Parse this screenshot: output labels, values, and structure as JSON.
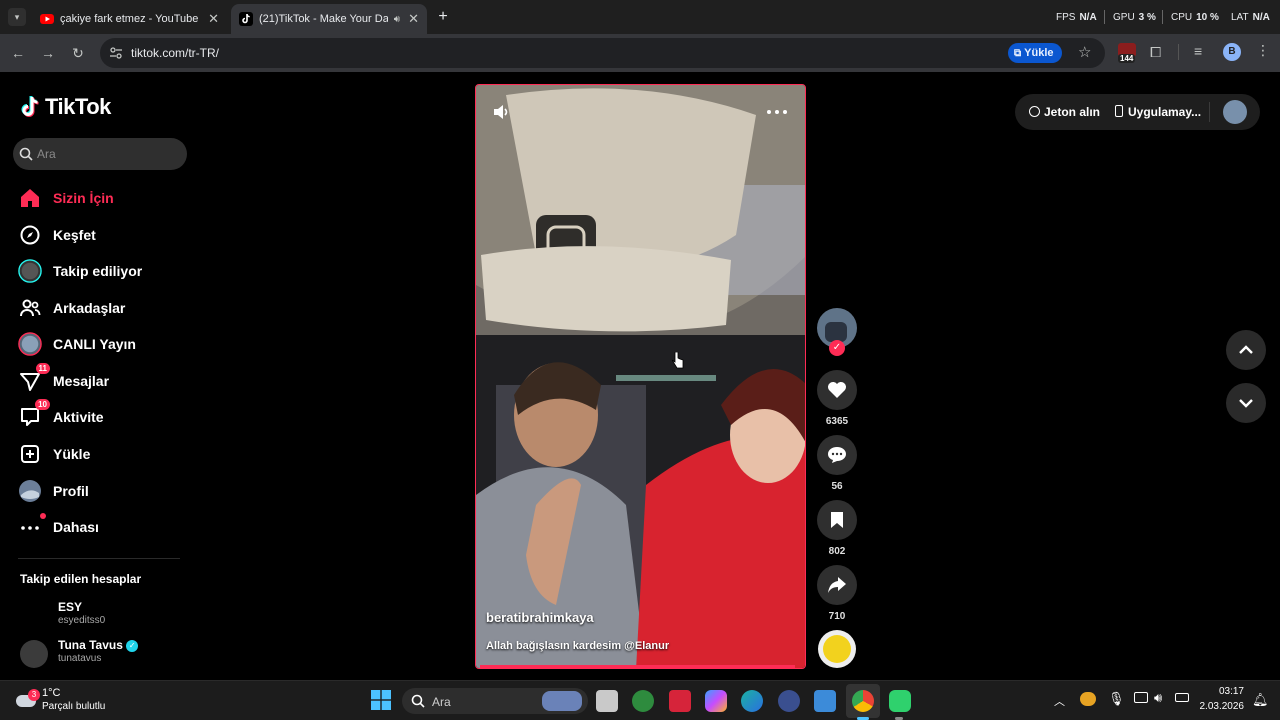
{
  "browser": {
    "tabs": [
      {
        "title": "çakiye fark etmez - YouTube",
        "icon": "youtube-icon"
      },
      {
        "title": "(21)TikTok - Make Your Day",
        "icon": "tiktok-icon"
      }
    ],
    "url": "tiktok.com/tr-TR/",
    "upload_label": "Yükle",
    "extension_badge": "144",
    "profile_initial": "B",
    "stats": {
      "fps_label": "FPS",
      "fps_value": "N/A",
      "gpu_label": "GPU",
      "gpu_value": "3 %",
      "cpu_label": "CPU",
      "cpu_value": "10 %",
      "lat_label": "LAT",
      "lat_value": "N/A"
    }
  },
  "tiktok": {
    "brand": "TikTok",
    "search_placeholder": "Ara",
    "nav": [
      {
        "label": "Sizin İçin",
        "icon": "home-icon",
        "active": true
      },
      {
        "label": "Keşfet",
        "icon": "compass-icon"
      },
      {
        "label": "Takip ediliyor",
        "icon": "following-icon"
      },
      {
        "label": "Arkadaşlar",
        "icon": "friends-icon"
      },
      {
        "label": "CANLI Yayın",
        "icon": "live-icon"
      },
      {
        "label": "Mesajlar",
        "icon": "messages-icon",
        "badge": "11"
      },
      {
        "label": "Aktivite",
        "icon": "activity-icon",
        "badge": "10"
      },
      {
        "label": "Yükle",
        "icon": "upload-icon"
      },
      {
        "label": "Profil",
        "icon": "profile-icon"
      },
      {
        "label": "Dahası",
        "icon": "more-icon"
      }
    ],
    "followed_title": "Takip edilen hesaplar",
    "followed": [
      {
        "name": "ESY",
        "username": "esyeditss0"
      },
      {
        "name": "Tuna Tavus",
        "username": "tunatavus",
        "verified": true
      }
    ],
    "top_right": {
      "coins": "Jeton alın",
      "app": "Uygulamay..."
    },
    "video": {
      "author": "beratibrahimkaya",
      "caption": "Allah bağışlasın kardesim @Elanur",
      "progress": 0.98
    },
    "actions": {
      "likes": "6365",
      "comments": "56",
      "saves": "802",
      "shares": "710"
    }
  },
  "taskbar": {
    "temperature": "1°C",
    "weather": "Parçalı bulutlu",
    "search_placeholder": "Ara",
    "time": "03:17",
    "date": "2.03.2026"
  }
}
